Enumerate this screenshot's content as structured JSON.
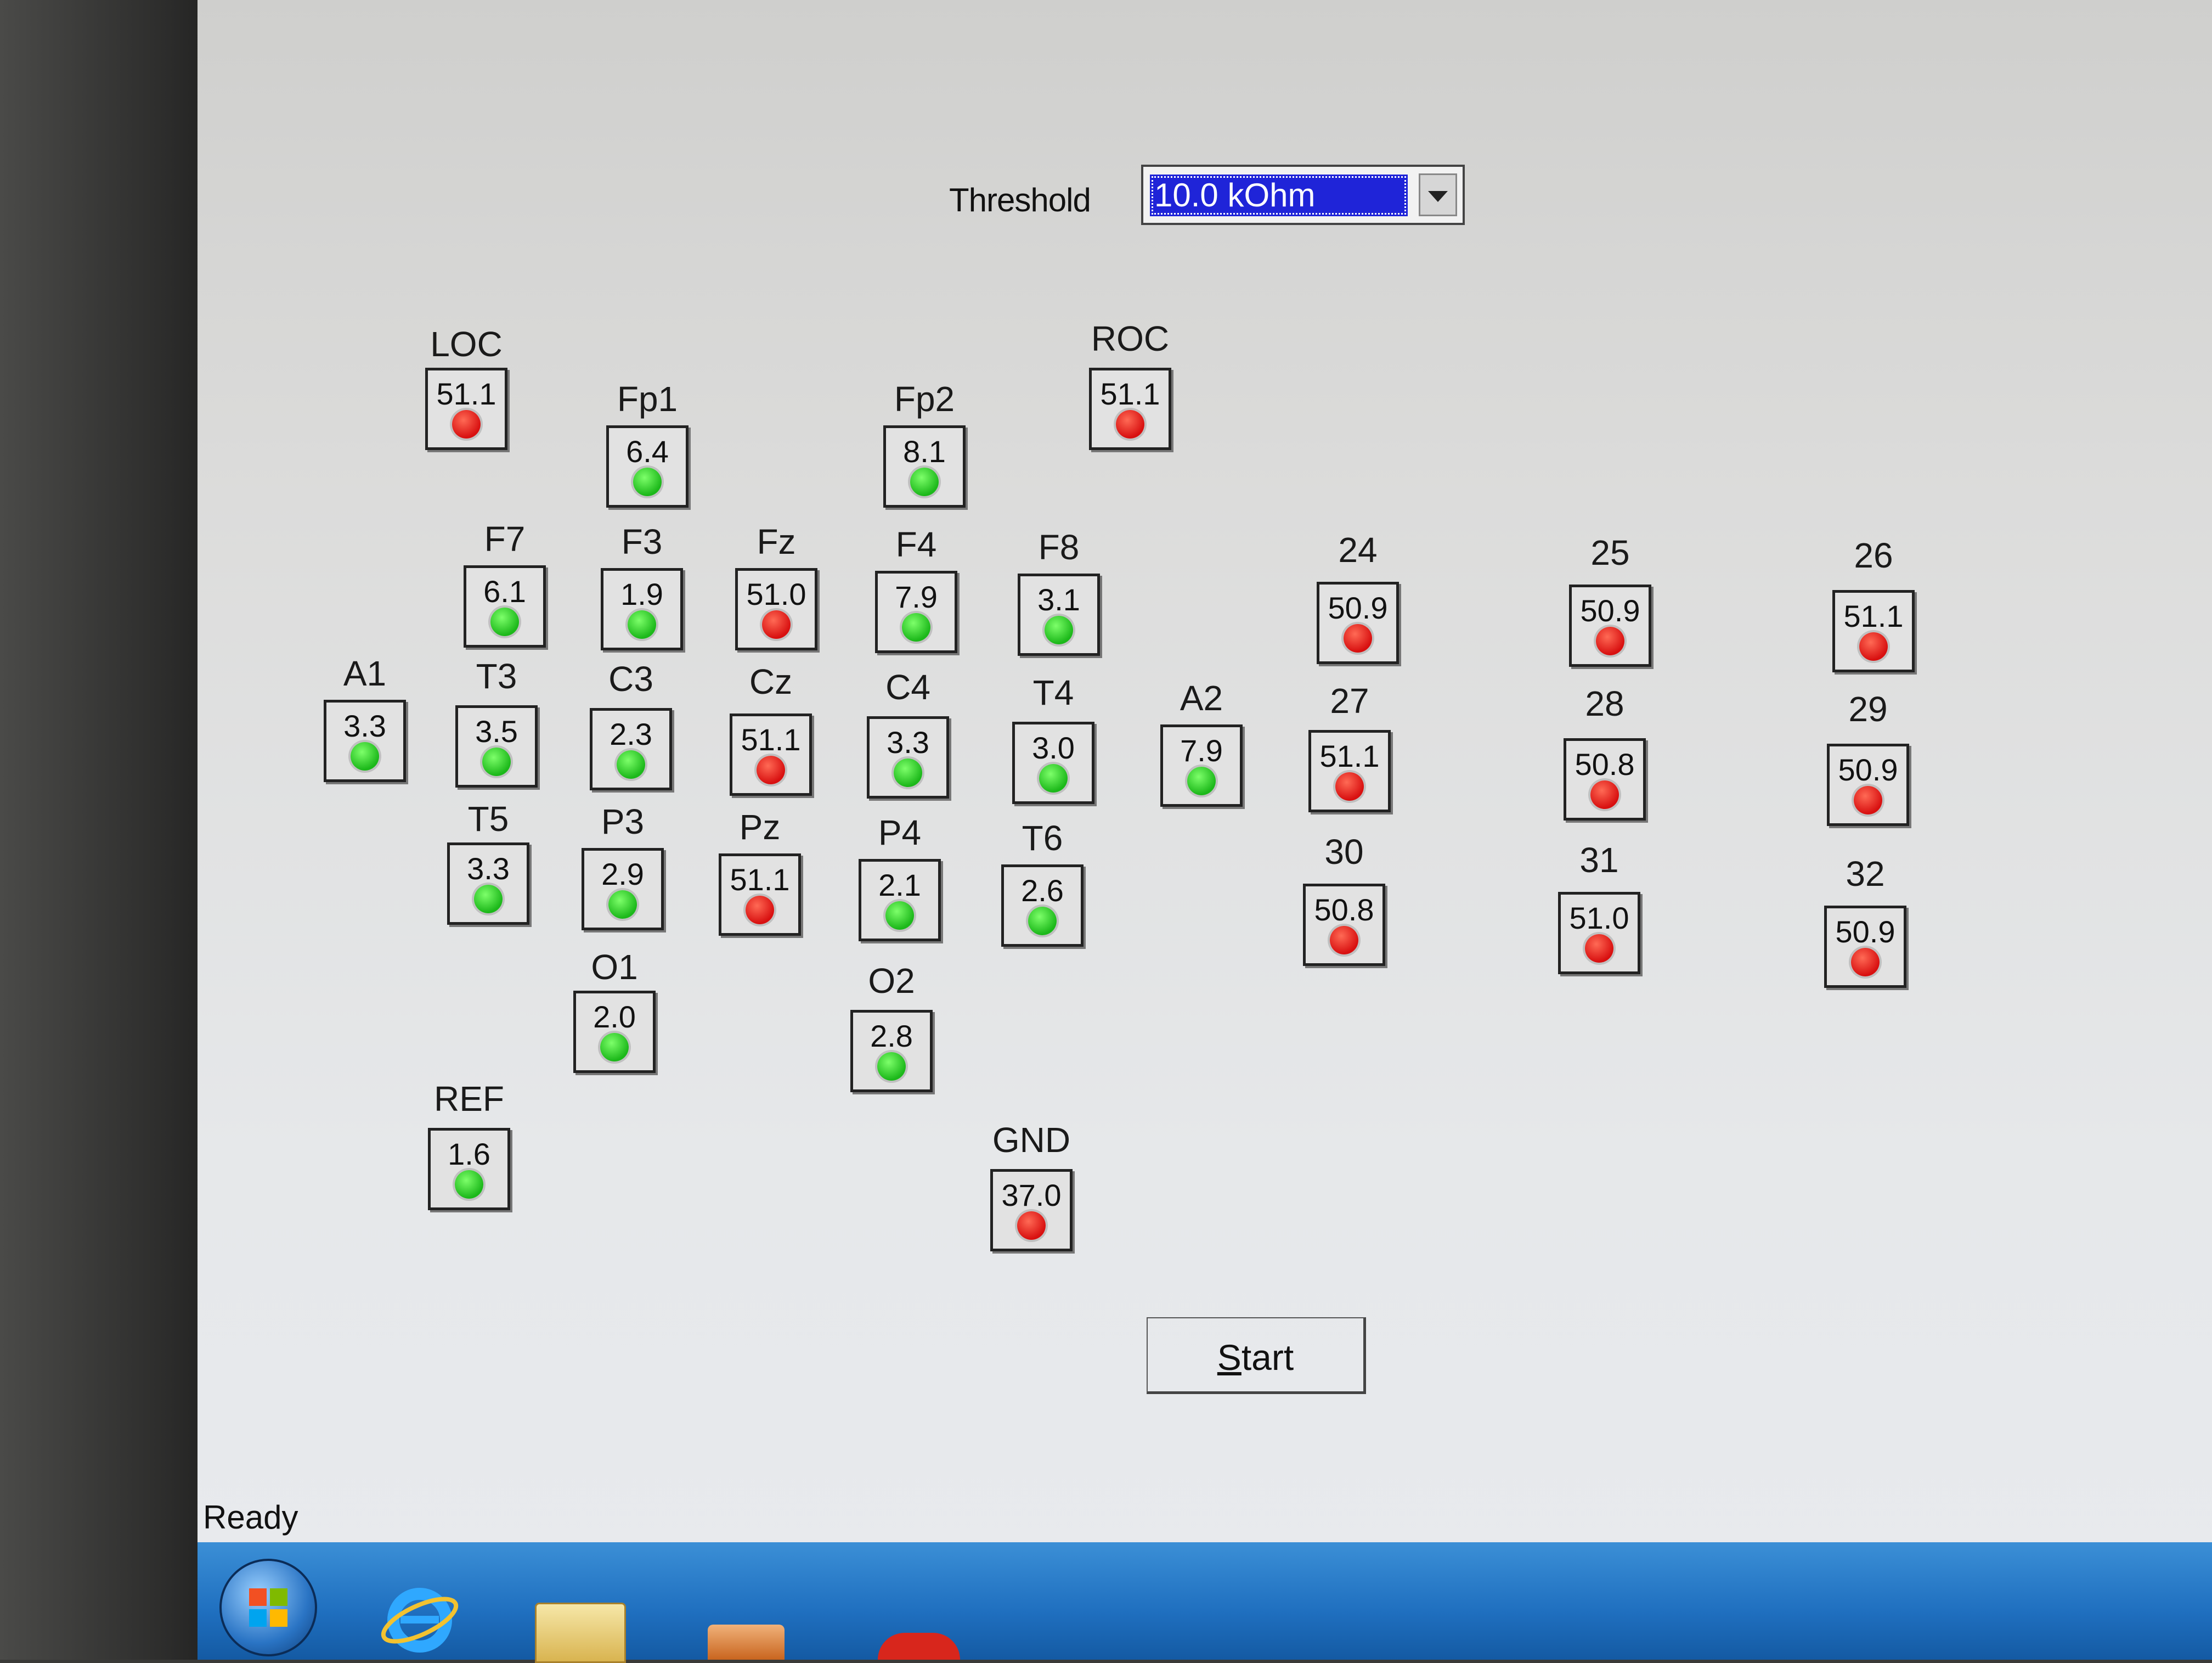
{
  "threshold": {
    "label": "Threshold",
    "value": "10.0 kOhm"
  },
  "electrodes": [
    {
      "id": "LOC",
      "value": "51.1",
      "status": "bad"
    },
    {
      "id": "Fp1",
      "value": "6.4",
      "status": "good"
    },
    {
      "id": "Fp2",
      "value": "8.1",
      "status": "good"
    },
    {
      "id": "ROC",
      "value": "51.1",
      "status": "bad"
    },
    {
      "id": "F7",
      "value": "6.1",
      "status": "good"
    },
    {
      "id": "F3",
      "value": "1.9",
      "status": "good"
    },
    {
      "id": "Fz",
      "value": "51.0",
      "status": "bad"
    },
    {
      "id": "F4",
      "value": "7.9",
      "status": "good"
    },
    {
      "id": "F8",
      "value": "3.1",
      "status": "good"
    },
    {
      "id": "24",
      "value": "50.9",
      "status": "bad"
    },
    {
      "id": "25",
      "value": "50.9",
      "status": "bad"
    },
    {
      "id": "26",
      "value": "51.1",
      "status": "bad"
    },
    {
      "id": "A1",
      "value": "3.3",
      "status": "good"
    },
    {
      "id": "T3",
      "value": "3.5",
      "status": "good"
    },
    {
      "id": "C3",
      "value": "2.3",
      "status": "good"
    },
    {
      "id": "Cz",
      "value": "51.1",
      "status": "bad"
    },
    {
      "id": "C4",
      "value": "3.3",
      "status": "good"
    },
    {
      "id": "T4",
      "value": "3.0",
      "status": "good"
    },
    {
      "id": "A2",
      "value": "7.9",
      "status": "good"
    },
    {
      "id": "27",
      "value": "51.1",
      "status": "bad"
    },
    {
      "id": "28",
      "value": "50.8",
      "status": "bad"
    },
    {
      "id": "29",
      "value": "50.9",
      "status": "bad"
    },
    {
      "id": "T5",
      "value": "3.3",
      "status": "good"
    },
    {
      "id": "P3",
      "value": "2.9",
      "status": "good"
    },
    {
      "id": "Pz",
      "value": "51.1",
      "status": "bad"
    },
    {
      "id": "P4",
      "value": "2.1",
      "status": "good"
    },
    {
      "id": "T6",
      "value": "2.6",
      "status": "good"
    },
    {
      "id": "30",
      "value": "50.8",
      "status": "bad"
    },
    {
      "id": "31",
      "value": "51.0",
      "status": "bad"
    },
    {
      "id": "32",
      "value": "50.9",
      "status": "bad"
    },
    {
      "id": "O1",
      "value": "2.0",
      "status": "good"
    },
    {
      "id": "O2",
      "value": "2.8",
      "status": "good"
    },
    {
      "id": "REF",
      "value": "1.6",
      "status": "good"
    },
    {
      "id": "GND",
      "value": "37.0",
      "status": "bad"
    }
  ],
  "start_button": {
    "label": "Start",
    "mnemonic": "S",
    "rest": "tart"
  },
  "status_bar": {
    "text": "Ready"
  },
  "taskbar": {
    "icons": [
      "windows-start-icon",
      "internet-explorer-icon",
      "folder-icon",
      "media-player-icon",
      "red-app-icon"
    ]
  },
  "colors": {
    "good": "#1cb81a",
    "bad": "#d81010",
    "selection": "#1f24d8",
    "taskbar": "#1f6fbf"
  }
}
